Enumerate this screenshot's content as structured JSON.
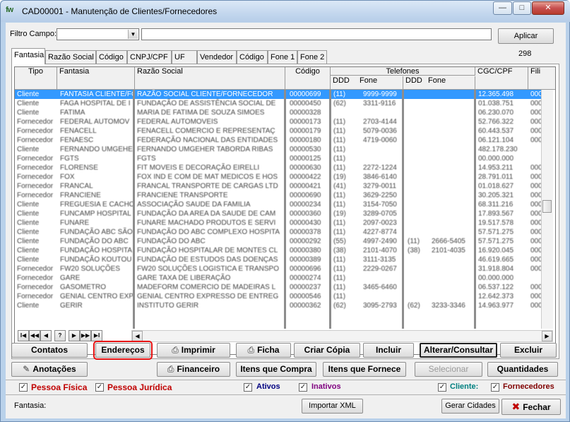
{
  "window": {
    "title": "CAD00001 - Manutenção de Clientes/Fornecedores",
    "app_icon_text": "fw"
  },
  "filter": {
    "label": "Filtro Campo:",
    "field_value": "",
    "search_value": "",
    "apply_label": "Aplicar",
    "record_count": "298"
  },
  "tabs": [
    {
      "label": "Fantasia"
    },
    {
      "label": "Razão Social"
    },
    {
      "label": "Código"
    },
    {
      "label": "CNPJ/CPF"
    },
    {
      "label": "UF"
    },
    {
      "label": "Vendedor"
    },
    {
      "label": "Código"
    },
    {
      "label": "Fone 1"
    },
    {
      "label": "Fone 2"
    }
  ],
  "grid": {
    "headers": {
      "tipo": "Tipo",
      "fantasia": "Fantasia",
      "razao": "Razão Social",
      "codigo": "Código",
      "telefones": "Telefones",
      "ddd1": "DDD",
      "fone1": "Fone",
      "ddd2": "DDD",
      "fone2": "Fone",
      "cgc": "CGC/CPF",
      "fili": "Fili"
    },
    "rows": [
      {
        "tipo": "Cliente",
        "fantasia": "FANTASIA CLIENTE/FORNECEDOR",
        "razao": "RAZÃO SOCIAL CLIENTE/FORNECEDOR",
        "codigo": "00000699",
        "ddd1": "(11)",
        "fone1": "9999-9999",
        "ddd2": "",
        "fone2": "",
        "cgc": "12.365.498",
        "fili": "000"
      },
      {
        "tipo": "Cliente",
        "fantasia": "FAGA HOSPITAL DE I",
        "razao": "FUNDAÇÃO DE ASSISTÊNCIA SOCIAL DE",
        "codigo": "00000450",
        "ddd1": "(62)",
        "fone1": "3311-9116",
        "ddd2": "",
        "fone2": "",
        "cgc": "01.038.751",
        "fili": "000"
      },
      {
        "tipo": "Cliente",
        "fantasia": "FATIMA",
        "razao": "MARIA DE FATIMA DE SOUZA SIMOES",
        "codigo": "00000328",
        "ddd1": "",
        "fone1": "",
        "ddd2": "",
        "fone2": "",
        "cgc": "06.230.070",
        "fili": "000"
      },
      {
        "tipo": "Fornecedor",
        "fantasia": "FEDERAL AUTOMOV",
        "razao": "FEDERAL AUTOMOVEIS",
        "codigo": "00000173",
        "ddd1": "(11)",
        "fone1": "2703-4144",
        "ddd2": "",
        "fone2": "",
        "cgc": "52.766.322",
        "fili": "000"
      },
      {
        "tipo": "Fornecedor",
        "fantasia": "FENACELL",
        "razao": "FENACELL COMERCIO E REPRESENTAÇ",
        "codigo": "00000179",
        "ddd1": "(11)",
        "fone1": "5079-0036",
        "ddd2": "",
        "fone2": "",
        "cgc": "60.443.537",
        "fili": "000"
      },
      {
        "tipo": "Fornecedor",
        "fantasia": "FENAESC",
        "razao": "FEDERAÇÃO NACIONAL DAS ENTIDADES",
        "codigo": "00000180",
        "ddd1": "(11)",
        "fone1": "4719-0060",
        "ddd2": "",
        "fone2": "",
        "cgc": "06.121.104",
        "fili": "000"
      },
      {
        "tipo": "Cliente",
        "fantasia": "FERNANDO UMGEHER",
        "razao": "FERNANDO UMGEHER TABORDA RIBAS",
        "codigo": "00000530",
        "ddd1": "(11)",
        "fone1": "",
        "ddd2": "",
        "fone2": "",
        "cgc": "482.178.230",
        "fili": ""
      },
      {
        "tipo": "Fornecedor",
        "fantasia": "FGTS",
        "razao": "FGTS",
        "codigo": "00000125",
        "ddd1": "(11)",
        "fone1": "",
        "ddd2": "",
        "fone2": "",
        "cgc": "00.000.000",
        "fili": ""
      },
      {
        "tipo": "Fornecedor",
        "fantasia": "FLORENSE",
        "razao": "FIT MOVEIS E DECORAÇÃO EIRELLI",
        "codigo": "00000630",
        "ddd1": "(11)",
        "fone1": "2272-1224",
        "ddd2": "",
        "fone2": "",
        "cgc": "14.953.211",
        "fili": "000"
      },
      {
        "tipo": "Fornecedor",
        "fantasia": "FOX",
        "razao": "FOX IND E COM DE MAT MEDICOS E HOS",
        "codigo": "00000422",
        "ddd1": "(19)",
        "fone1": "3846-6140",
        "ddd2": "",
        "fone2": "",
        "cgc": "28.791.011",
        "fili": "000"
      },
      {
        "tipo": "Fornecedor",
        "fantasia": "FRANCAL",
        "razao": "FRANCAL TRANSPORTE DE CARGAS LTD",
        "codigo": "00000421",
        "ddd1": "(41)",
        "fone1": "3279-0011",
        "ddd2": "",
        "fone2": "",
        "cgc": "01.018.627",
        "fili": "000"
      },
      {
        "tipo": "Fornecedor",
        "fantasia": "FRANCIENE",
        "razao": "FRANCIENE TRANSPORTE",
        "codigo": "00000690",
        "ddd1": "(11)",
        "fone1": "3629-2250",
        "ddd2": "",
        "fone2": "",
        "cgc": "30.205.321",
        "fili": "000"
      },
      {
        "tipo": "Cliente",
        "fantasia": "FREGUESIA E CACHO",
        "razao": "ASSOCIAÇÃO SAUDE DA FAMILIA",
        "codigo": "00000234",
        "ddd1": "(11)",
        "fone1": "3154-7050",
        "ddd2": "",
        "fone2": "",
        "cgc": "68.311.216",
        "fili": "000"
      },
      {
        "tipo": "Cliente",
        "fantasia": "FUNCAMP HOSPITAL",
        "razao": "FUNDAÇÃO DA AREA DA SAUDE DE CAM",
        "codigo": "00000360",
        "ddd1": "(19)",
        "fone1": "3289-0705",
        "ddd2": "",
        "fone2": "",
        "cgc": "17.893.567",
        "fili": "000"
      },
      {
        "tipo": "Cliente",
        "fantasia": "FUNARE",
        "razao": "FUNARE MACHADO PRODUTOS E SERVI",
        "codigo": "00000430",
        "ddd1": "(11)",
        "fone1": "2097-0023",
        "ddd2": "",
        "fone2": "",
        "cgc": "19.517.578",
        "fili": "000"
      },
      {
        "tipo": "Cliente",
        "fantasia": "FUNDAÇÃO ABC SÃO",
        "razao": "FUNDAÇÃO DO ABC COMPLEXO HOSPITA",
        "codigo": "00000378",
        "ddd1": "(11)",
        "fone1": "4227-8774",
        "ddd2": "",
        "fone2": "",
        "cgc": "57.571.275",
        "fili": "000"
      },
      {
        "tipo": "Cliente",
        "fantasia": "FUNDAÇÃO DO ABC",
        "razao": "FUNDAÇÃO DO ABC",
        "codigo": "00000292",
        "ddd1": "(55)",
        "fone1": "4997-2490",
        "ddd2": "(11)",
        "fone2": "2666-5405",
        "cgc": "57.571.275",
        "fili": "000"
      },
      {
        "tipo": "Cliente",
        "fantasia": "FUNDAÇÃO HOSPITA",
        "razao": "FUNDAÇÃO HOSPITALAR DE MONTES CL",
        "codigo": "00000380",
        "ddd1": "(38)",
        "fone1": "2101-4070",
        "ddd2": "(38)",
        "fone2": "2101-4035",
        "cgc": "16.920.045",
        "fili": "000"
      },
      {
        "tipo": "Cliente",
        "fantasia": "FUNDAÇÃO KOUTOU",
        "razao": "FUNDAÇÃO DE ESTUDOS DAS DOENÇAS",
        "codigo": "00000389",
        "ddd1": "(11)",
        "fone1": "3111-3135",
        "ddd2": "",
        "fone2": "",
        "cgc": "46.619.665",
        "fili": "000"
      },
      {
        "tipo": "Fornecedor",
        "fantasia": "FW20 SOLUÇÕES",
        "razao": "FW20 SOLUÇÕES LOGISTICA E TRANSPO",
        "codigo": "00000696",
        "ddd1": "(11)",
        "fone1": "2229-0267",
        "ddd2": "",
        "fone2": "",
        "cgc": "31.918.804",
        "fili": "000"
      },
      {
        "tipo": "Fornecedor",
        "fantasia": "GARE",
        "razao": "GARE TAXA DE LIBERAÇÃO",
        "codigo": "00000274",
        "ddd1": "(11)",
        "fone1": "",
        "ddd2": "",
        "fone2": "",
        "cgc": "00.000.000",
        "fili": ""
      },
      {
        "tipo": "Fornecedor",
        "fantasia": "GASOMETRO",
        "razao": "MADEFORM COMERCIO DE MADEIRAS L",
        "codigo": "00000237",
        "ddd1": "(11)",
        "fone1": "3465-6460",
        "ddd2": "",
        "fone2": "",
        "cgc": "06.537.122",
        "fili": "000"
      },
      {
        "tipo": "Fornecedor",
        "fantasia": "GENIAL CENTRO EXP",
        "razao": "GENIAL CENTRO EXPRESSO DE ENTREG",
        "codigo": "00000546",
        "ddd1": "(11)",
        "fone1": "",
        "ddd2": "",
        "fone2": "",
        "cgc": "12.642.373",
        "fili": "000"
      },
      {
        "tipo": "Cliente",
        "fantasia": "GERIR",
        "razao": "INSTITUTO GERIR",
        "codigo": "00000362",
        "ddd1": "(62)",
        "fone1": "3095-2793",
        "ddd2": "(62)",
        "fone2": "3233-3346",
        "cgc": "14.963.977",
        "fili": "000"
      }
    ],
    "nav_buttons": [
      "I◀",
      "◀◀",
      "◀",
      "?",
      "▶",
      "▶▶",
      "▶I"
    ]
  },
  "buttons": {
    "contatos": "Contatos",
    "enderecos": "Endereços",
    "imprimir": "Imprimir",
    "ficha": "Ficha",
    "criar_copia": "Criar Cópia",
    "incluir": "Incluir",
    "alterar": "Alterar/Consultar",
    "excluir": "Excluir",
    "anotacoes": "Anotações",
    "financeiro": "Financeiro",
    "itens_compra": "Itens que Compra",
    "itens_fornece": "Itens que Fornece",
    "selecionar": "Selecionar",
    "quantidades": "Quantidades",
    "importar_xml": "Importar XML",
    "gerar_cidades": "Gerar Cidades",
    "fechar": "Fechar"
  },
  "filters": {
    "pessoa_fisica": "Pessoa Física",
    "pessoa_juridica": "Pessoa Jurídica",
    "ativos": "Ativos",
    "inativos": "Inativos",
    "cliente": "Cliente:",
    "fornecedores": "Fornecedores"
  },
  "footer": {
    "fantasia_label": "Fantasia:"
  },
  "colors": {
    "selection": "#3399ff",
    "pessoa": "#c00000",
    "ativos": "#000080",
    "inativos": "#800080",
    "cliente": "#008080",
    "fornecedores": "#800000",
    "highlight": "#e41010"
  }
}
